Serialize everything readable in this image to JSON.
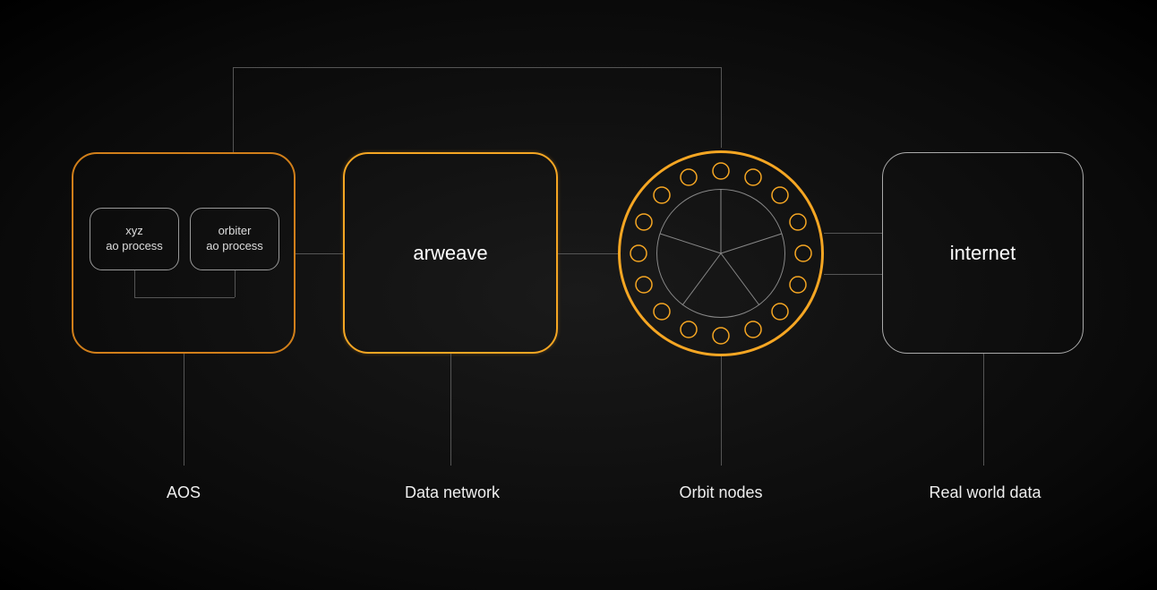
{
  "nodes": {
    "aos": {
      "sub1_line1": "xyz",
      "sub1_line2": "ao process",
      "sub2_line1": "orbiter",
      "sub2_line2": "ao process"
    },
    "arweave": {
      "title": "arweave"
    },
    "internet": {
      "title": "internet"
    }
  },
  "labels": {
    "aos": "AOS",
    "data_network": "Data network",
    "orbit_nodes": "Orbit nodes",
    "real_world_data": "Real world data"
  },
  "colors": {
    "orange": "#f5a623",
    "dark_orange": "#d17f1a",
    "line": "#555"
  }
}
